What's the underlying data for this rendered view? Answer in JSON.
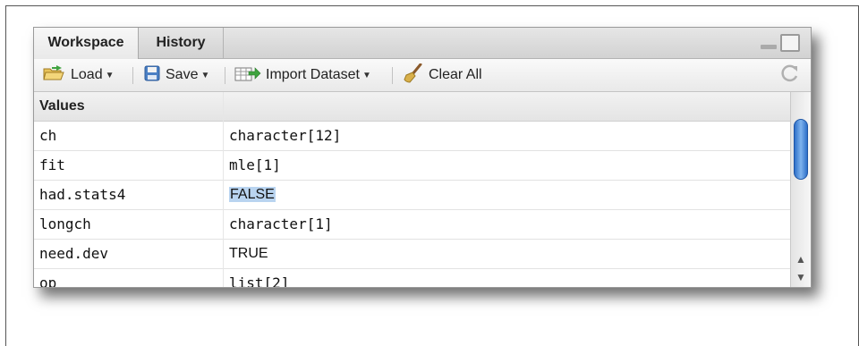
{
  "tabs": [
    {
      "label": "Workspace",
      "active": true
    },
    {
      "label": "History",
      "active": false
    }
  ],
  "toolbar": {
    "load": "Load",
    "save": "Save",
    "import": "Import Dataset",
    "clear": "Clear All"
  },
  "table": {
    "section": "Values",
    "rows": [
      {
        "name": "ch",
        "value": "character[12]"
      },
      {
        "name": "fit",
        "value": "mle[1]"
      },
      {
        "name": "had.stats4",
        "value": "FALSE"
      },
      {
        "name": "longch",
        "value": "character[1]"
      },
      {
        "name": "need.dev",
        "value": "TRUE"
      },
      {
        "name": "op",
        "value": "list[2]"
      }
    ]
  },
  "colors": {
    "selection": "#b9d4f0",
    "scroll_thumb": "#2e6fc9"
  },
  "icons": {
    "load": "folder-open-icon",
    "save": "floppy-disk-icon",
    "import": "table-import-icon",
    "clear": "broom-icon",
    "refresh": "refresh-icon"
  }
}
